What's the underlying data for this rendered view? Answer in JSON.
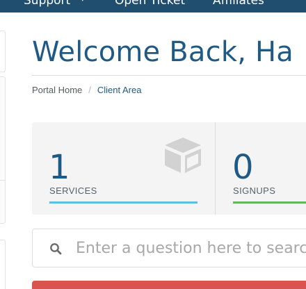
{
  "nav": {
    "support_label": "Support",
    "caret": "▾",
    "open_ticket_label": "Open Ticket",
    "affiliates_label": "Affiliates"
  },
  "page": {
    "title": "Welcome Back, Ha"
  },
  "breadcrumb": {
    "home": "Portal Home",
    "separator": "/",
    "current": "Client Area"
  },
  "tiles": [
    {
      "value": "1",
      "label": "SERVICES",
      "icon": "cube-icon",
      "accent": "#5bc0de"
    },
    {
      "value": "0",
      "label": "SIGNUPS",
      "accent": "#5cb85c"
    }
  ],
  "search": {
    "placeholder": "Enter a question here to search our knowledgebase for answers..."
  },
  "colors": {
    "nav_bg": "#1f4e6f",
    "brand": "#1f5a87",
    "alert": "#d9534f"
  }
}
